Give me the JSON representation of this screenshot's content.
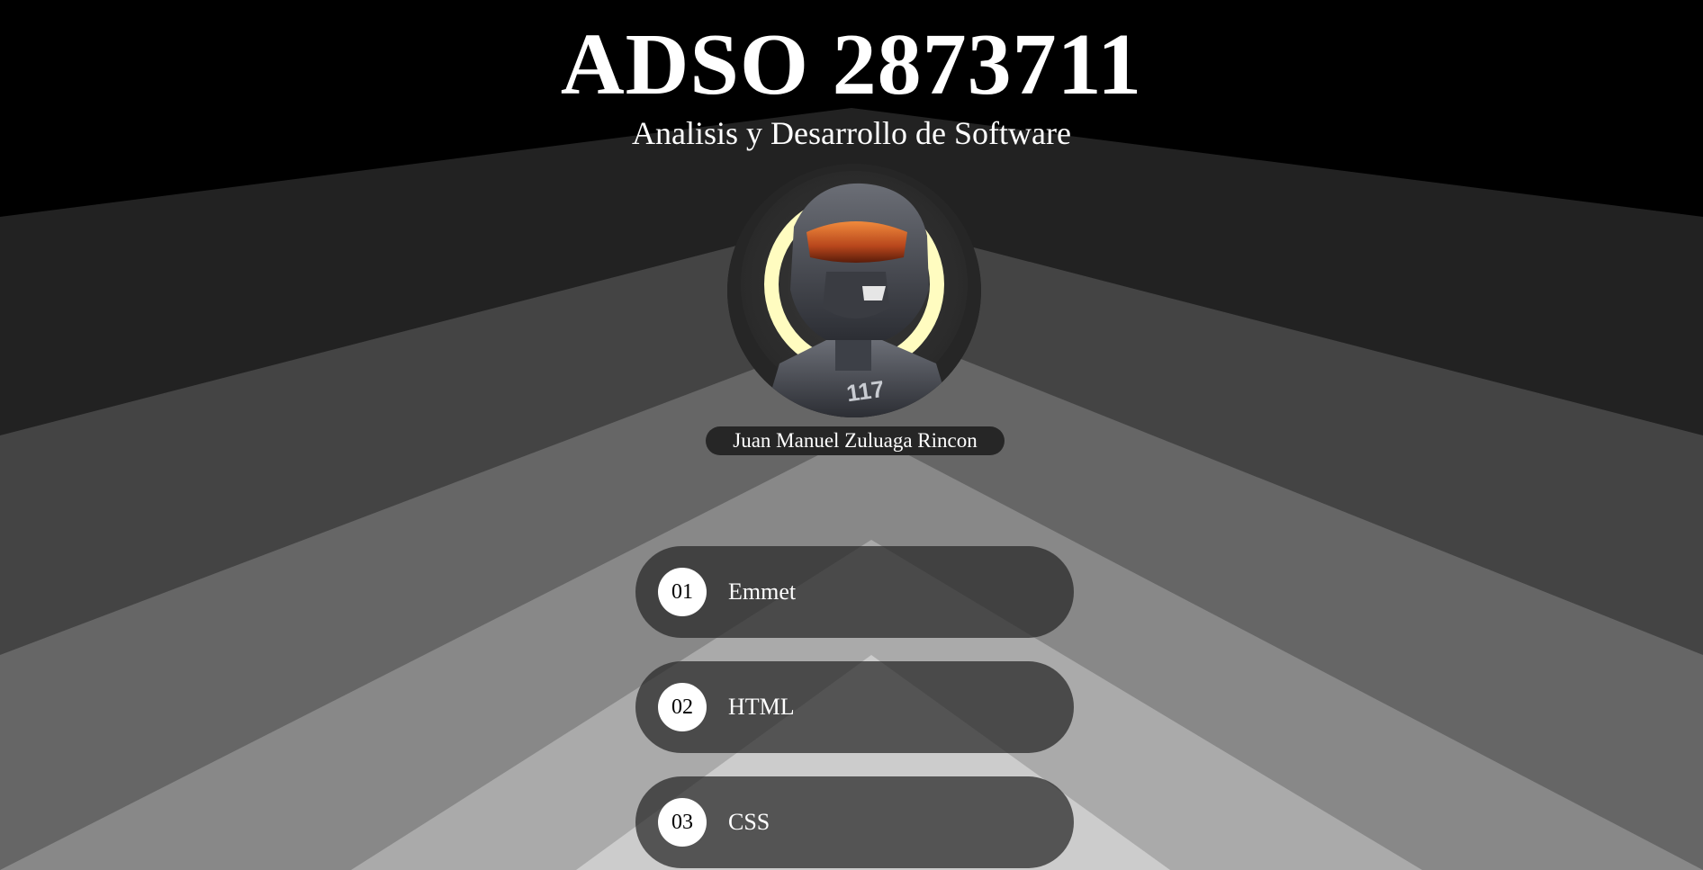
{
  "page": {
    "title": "ADSO 2873711",
    "subtitle": "Analisis y Desarrollo de Software"
  },
  "profile": {
    "name": "Juan Manuel Zuluaga Rincon",
    "armor_number": "117"
  },
  "menu": [
    {
      "number": "01",
      "label": "Emmet"
    },
    {
      "number": "02",
      "label": "HTML"
    },
    {
      "number": "03",
      "label": "CSS"
    }
  ],
  "colors": {
    "background": "#000000",
    "pill": "#262626",
    "text": "#ffffff",
    "bands": [
      "#222222",
      "#444444",
      "#666666",
      "#888888",
      "#aaaaaa",
      "#cccccc"
    ]
  }
}
